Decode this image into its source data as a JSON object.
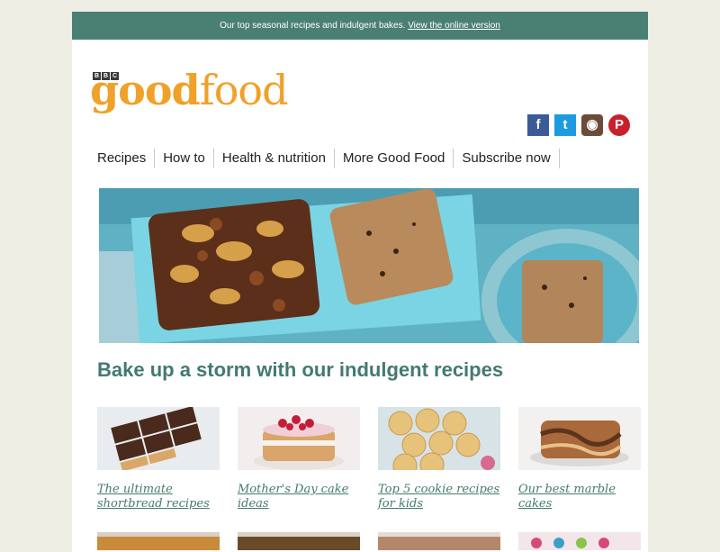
{
  "topbar": {
    "text": "Our top seasonal recipes and indulgent bakes.",
    "link": "View the online version"
  },
  "brand": {
    "bbc": [
      "B",
      "B",
      "C"
    ],
    "good": "good",
    "food": "food"
  },
  "social": {
    "facebook": "f",
    "twitter": "t",
    "instagram": "◉",
    "pinterest": "P"
  },
  "nav": [
    "Recipes",
    "How to",
    "Health & nutrition",
    "More Good Food",
    "Subscribe now"
  ],
  "headline": "Bake up a storm with our indulgent recipes",
  "cards": [
    {
      "caption": "The ultimate shortbread recipes"
    },
    {
      "caption": "Mother's Day cake ideas"
    },
    {
      "caption": "Top 5 cookie recipes for kids"
    },
    {
      "caption": "Our best marble cakes"
    }
  ],
  "colors": {
    "accent": "#4a7f74",
    "brand": "#f0a12a",
    "link": "#447a70"
  }
}
